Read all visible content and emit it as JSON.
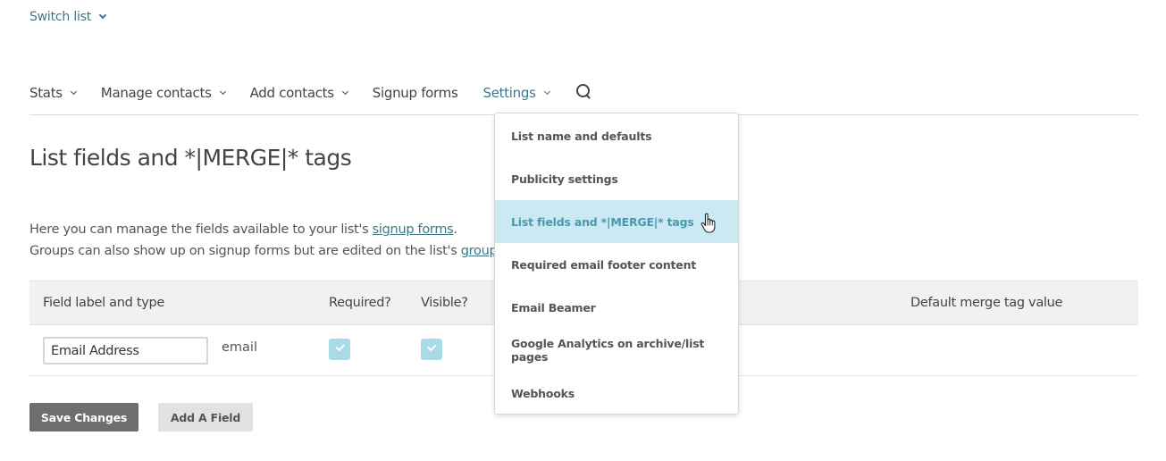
{
  "header": {
    "switch_list_label": "Switch list"
  },
  "nav": {
    "items": [
      {
        "label": "Stats",
        "has_dropdown": true,
        "active": false
      },
      {
        "label": "Manage contacts",
        "has_dropdown": true,
        "active": false
      },
      {
        "label": "Add contacts",
        "has_dropdown": true,
        "active": false
      },
      {
        "label": "Signup forms",
        "has_dropdown": false,
        "active": false
      },
      {
        "label": "Settings",
        "has_dropdown": true,
        "active": true
      }
    ],
    "search_icon": "search-icon"
  },
  "page": {
    "title": "List fields and *|MERGE|* tags",
    "intro": {
      "line1_prefix": "Here you can manage the fields available to your list's ",
      "line1_link": "signup forms",
      "line1_suffix": ".",
      "line2_prefix": "Groups can also show up on signup forms but are edited on the list's ",
      "line2_link": "groups"
    }
  },
  "table": {
    "headers": {
      "field_label": "Field label and type",
      "required": "Required?",
      "visible": "Visible?",
      "default_value": "Default merge tag value"
    },
    "rows": [
      {
        "label_value": "Email Address",
        "type": "email",
        "required": true,
        "visible": true,
        "default_value": ""
      }
    ]
  },
  "buttons": {
    "save": "Save Changes",
    "add_field": "Add A Field"
  },
  "settings_menu": {
    "items": [
      {
        "label": "List name and defaults"
      },
      {
        "label": "Publicity settings"
      },
      {
        "label": "List fields and *|MERGE|* tags",
        "hovered": true
      },
      {
        "label": "Required email footer content"
      },
      {
        "label": "Email Beamer"
      },
      {
        "label": "Google Analytics on archive/list pages"
      },
      {
        "label": "Webhooks"
      }
    ]
  },
  "colors": {
    "accent": "#3d7888",
    "hover_bg": "#cbe9f2",
    "checkbox": "#a9dae6",
    "primary_button": "#6e6e6e"
  }
}
